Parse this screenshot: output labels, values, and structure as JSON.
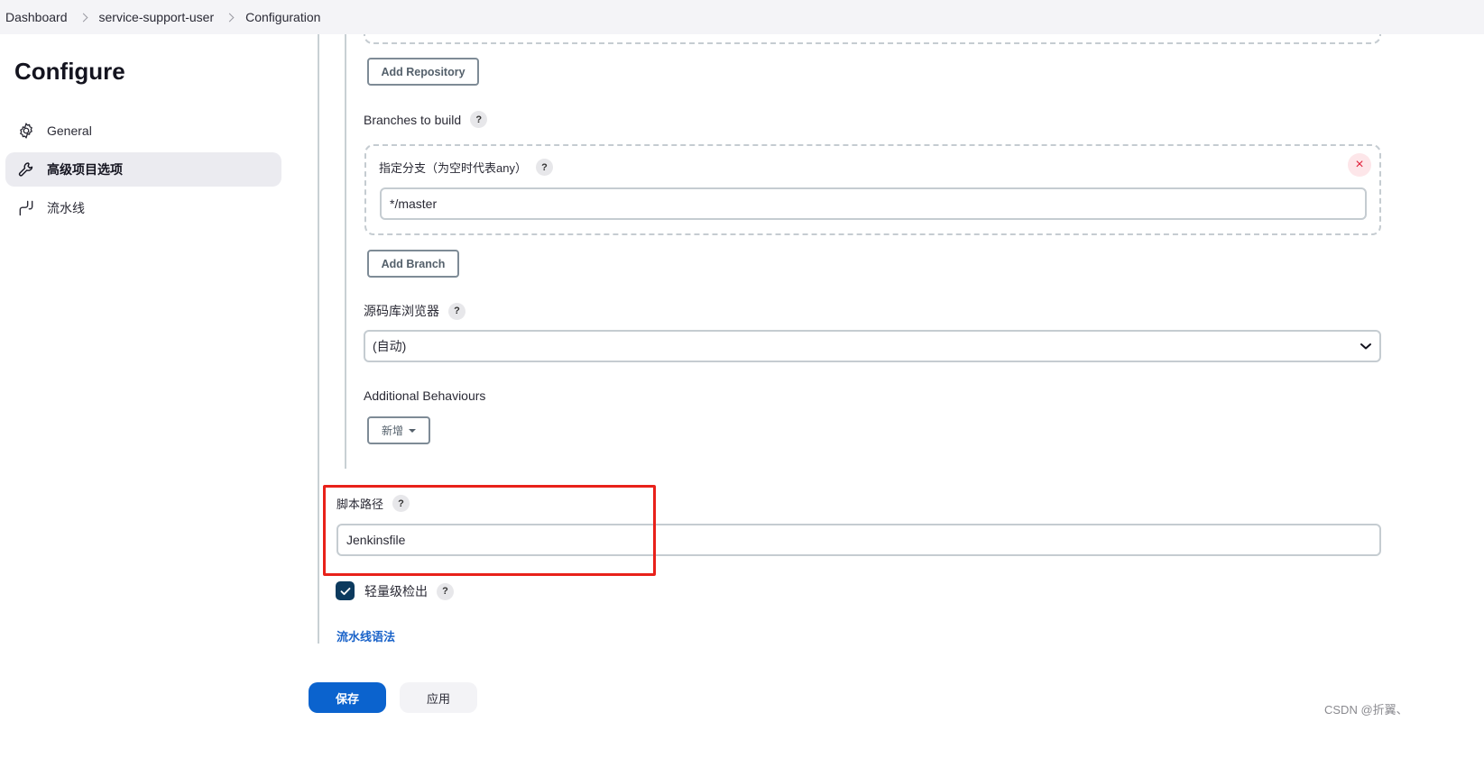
{
  "breadcrumb": [
    {
      "label": "Dashboard"
    },
    {
      "label": "service-support-user"
    },
    {
      "label": "Configuration"
    }
  ],
  "sidebar": {
    "title": "Configure",
    "items": [
      {
        "label": "General",
        "icon": "gear-icon",
        "active": false
      },
      {
        "label": "高级项目选项",
        "icon": "wrench-icon",
        "active": true
      },
      {
        "label": "流水线",
        "icon": "pipeline-icon",
        "active": false
      }
    ]
  },
  "scm": {
    "add_repository_label": "Add Repository",
    "branches_label": "Branches to build",
    "branch_specifier_label": "指定分支（为空时代表any）",
    "branch_specifier_value": "*/master",
    "add_branch_label": "Add Branch",
    "repo_browser_label": "源码库浏览器",
    "repo_browser_value": "(自动)",
    "additional_behaviours_label": "Additional Behaviours",
    "add_behaviour_label": "新增"
  },
  "pipeline": {
    "script_path_label": "脚本路径",
    "script_path_value": "Jenkinsfile",
    "lightweight_checkout_label": "轻量级检出",
    "lightweight_checkout_checked": true,
    "syntax_link_label": "流水线语法"
  },
  "help_glyph": "?",
  "remove_glyph": "×",
  "actions": {
    "save_label": "保存",
    "apply_label": "应用"
  },
  "colors": {
    "primary": "#0b63ce",
    "highlight": "#e8211a",
    "checkbox": "#0c3a5e",
    "link": "#1a63c9",
    "remove": "#e0213b"
  },
  "watermark": "CSDN @折翼、"
}
